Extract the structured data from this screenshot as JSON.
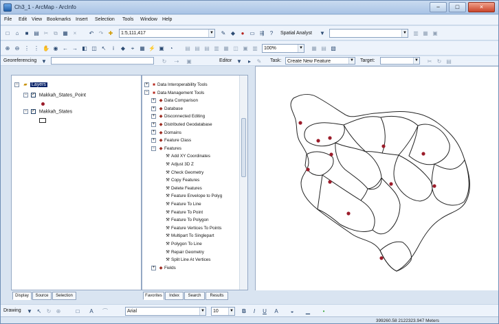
{
  "window": {
    "title": "Ch3_1 - ArcMap - ArcInfo",
    "min_icon": "−",
    "max_icon": "□",
    "close_icon": "×"
  },
  "menu": {
    "items": [
      "File",
      "Edit",
      "View",
      "Bookmarks",
      "Insert",
      "Selection",
      "Tools",
      "Window",
      "Help"
    ]
  },
  "toolbar": {
    "scale": "1:5,111,417",
    "spatial_analyst": "Spatial Analyst",
    "georeferencing": "Georeferencing",
    "editor": "Editor",
    "task_label": "Task:",
    "task_value": "Create New Feature",
    "target_label": "Target:",
    "zoom_percent": "100%"
  },
  "toc": {
    "root": "Layers",
    "layers": [
      {
        "name": "Makkah_States_Point"
      },
      {
        "name": "Makkah_States"
      }
    ],
    "tabs": [
      "Display",
      "Source",
      "Selection"
    ]
  },
  "toolbox": {
    "items": [
      {
        "label": "Data Interoperability Tools",
        "kind": "toolbox",
        "depth": 0,
        "expanded": false
      },
      {
        "label": "Data Management Tools",
        "kind": "toolbox",
        "depth": 0,
        "expanded": true
      },
      {
        "label": "Data Comparison",
        "kind": "toolset",
        "depth": 1,
        "expanded": false
      },
      {
        "label": "Database",
        "kind": "toolset",
        "depth": 1,
        "expanded": false
      },
      {
        "label": "Disconnected Editing",
        "kind": "toolset",
        "depth": 1,
        "expanded": false
      },
      {
        "label": "Distributed Geodatabase",
        "kind": "toolset",
        "depth": 1,
        "expanded": false
      },
      {
        "label": "Domains",
        "kind": "toolset",
        "depth": 1,
        "expanded": false
      },
      {
        "label": "Feature Class",
        "kind": "toolset",
        "depth": 1,
        "expanded": false
      },
      {
        "label": "Features",
        "kind": "toolset",
        "depth": 1,
        "expanded": true
      },
      {
        "label": "Add XY Coordinates",
        "kind": "tool",
        "depth": 2
      },
      {
        "label": "Adjust 3D Z",
        "kind": "tool",
        "depth": 2
      },
      {
        "label": "Check Geometry",
        "kind": "tool",
        "depth": 2
      },
      {
        "label": "Copy Features",
        "kind": "tool",
        "depth": 2
      },
      {
        "label": "Delete Features",
        "kind": "tool",
        "depth": 2
      },
      {
        "label": "Feature Envelope to Polyg",
        "kind": "tool",
        "depth": 2
      },
      {
        "label": "Feature To Line",
        "kind": "tool",
        "depth": 2
      },
      {
        "label": "Feature To Point",
        "kind": "tool",
        "depth": 2
      },
      {
        "label": "Feature To Polygon",
        "kind": "tool",
        "depth": 2
      },
      {
        "label": "Feature Vertices To Points",
        "kind": "tool",
        "depth": 2
      },
      {
        "label": "Multipart To Singlepart",
        "kind": "tool",
        "depth": 2
      },
      {
        "label": "Polygon To Line",
        "kind": "tool",
        "depth": 2
      },
      {
        "label": "Repair Geometry",
        "kind": "tool",
        "depth": 2
      },
      {
        "label": "Split Line At Vertices",
        "kind": "tool",
        "depth": 2
      },
      {
        "label": "Fields",
        "kind": "toolset",
        "depth": 1,
        "expanded": false
      }
    ],
    "tabs": [
      "Favorites",
      "Index",
      "Search",
      "Results"
    ]
  },
  "drawing": {
    "drawing_label": "Drawing",
    "font": "Arial",
    "font_size": "10"
  },
  "status": {
    "coordinates": "399260.58  2122323.947 Meters"
  },
  "colors": {
    "point": "#9b1c2a",
    "selection": "#0a246a",
    "map_outline": "#222222"
  }
}
